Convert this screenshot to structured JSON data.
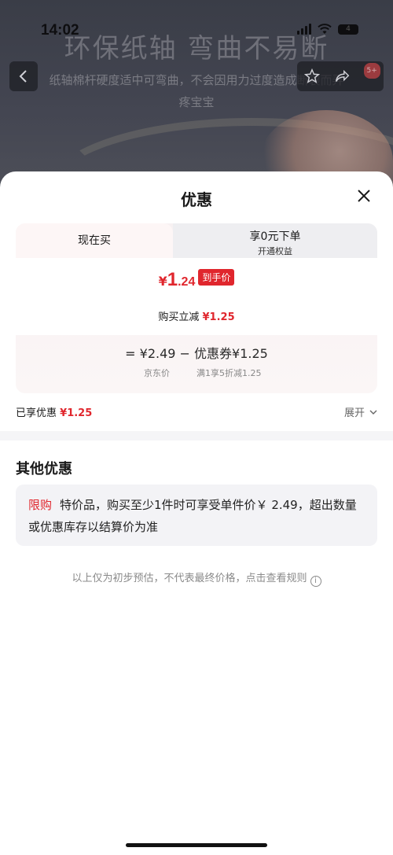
{
  "status_bar": {
    "time": "14:02",
    "battery": "4"
  },
  "background": {
    "title": "环保纸轴 弯曲不易断",
    "subtitle": "纸轴棉杆硬度适中可弯曲，不会因用力过度造成断裂而弄疼宝宝",
    "badge": "5+"
  },
  "sheet": {
    "title": "优惠"
  },
  "tabs": {
    "buy_now": "现在买",
    "zero_order": "享0元下单",
    "zero_order_sub": "开通权益"
  },
  "price": {
    "currency": "¥",
    "integer": "1",
    "decimal": ".24",
    "tag": "到手价",
    "reduce_label": "购买立减",
    "reduce_value": "¥1.25"
  },
  "formula": {
    "text": "= ¥2.49 − 优惠券¥1.25",
    "left_label": "京东价",
    "right_label": "满1享5折减1.25"
  },
  "enjoyed": {
    "label": "已享优惠",
    "value": "¥1.25",
    "expand": "展开"
  },
  "other": {
    "title": "其他优惠",
    "tag": "限购",
    "text": "特价品，购买至少1件时可享受单件价￥ 2.49，超出数量或优惠库存以结算价为准"
  },
  "footnote": "以上仅为初步预估，不代表最终价格，点击查看规则",
  "colors": {
    "accent": "#e0262d"
  }
}
